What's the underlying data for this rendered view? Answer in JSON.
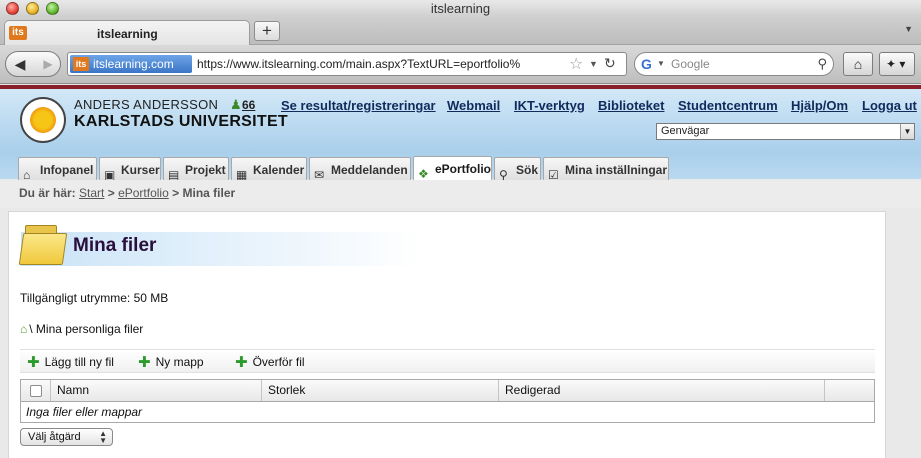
{
  "browser": {
    "window_title": "itslearning",
    "tab": {
      "favicon": "its",
      "title": "itslearning"
    },
    "new_tab_label": "+",
    "site_identity": "itslearning.com",
    "url": "https://www.itslearning.com/main.aspx?TextURL=eportfolio%",
    "search_placeholder": "Google"
  },
  "header": {
    "user_name": "ANDERS ANDERSSON",
    "university": "KARLSTADS UNIVERSITET",
    "online_count": "66",
    "links": [
      "Se resultat/registreringar",
      "Webmail",
      "IKT-verktyg",
      "Biblioteket",
      "Studentcentrum",
      "Hjälp/Om",
      "Logga ut"
    ],
    "shortcuts_select": "Genvägar"
  },
  "nav_tabs": [
    {
      "label": "Infopanel",
      "icon": "info-panel-icon",
      "active": false
    },
    {
      "label": "Kurser",
      "icon": "courses-icon",
      "active": false
    },
    {
      "label": "Projekt",
      "icon": "project-icon",
      "active": false
    },
    {
      "label": "Kalender",
      "icon": "calendar-icon",
      "active": false
    },
    {
      "label": "Meddelanden",
      "icon": "envelope-icon",
      "active": false
    },
    {
      "label": "ePortfolio",
      "icon": "eportfolio-icon",
      "active": true
    },
    {
      "label": "Sök",
      "icon": "search-icon",
      "active": false
    },
    {
      "label": "Mina inställningar",
      "icon": "settings-icon",
      "active": false
    }
  ],
  "breadcrumb": {
    "prefix": "Du är här:",
    "start": "Start",
    "sep1": ">",
    "eportfolio": "ePortfolio",
    "sep2": ">",
    "current": "Mina filer"
  },
  "main": {
    "title": "Mina filer",
    "available_space": "Tillgängligt utrymme: 50 MB",
    "path": "\\ Mina personliga filer",
    "toolbar": {
      "add_file": "Lägg till ny fil",
      "new_folder": "Ny mapp",
      "upload_file": "Överför fil"
    },
    "table": {
      "columns": [
        "Namn",
        "Storlek",
        "Redigerad"
      ],
      "empty_message": "Inga filer eller mappar"
    },
    "action_select": "Välj åtgärd"
  },
  "colors": {
    "header_top_stripe": "#8a1f2a",
    "link_color": "#112a5c",
    "title_color": "#2a0f3c",
    "add_green": "#2c9a2c"
  }
}
